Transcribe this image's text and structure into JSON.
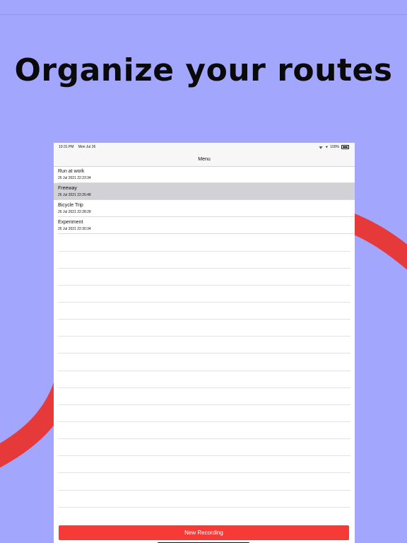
{
  "headline": "Organize your routes",
  "status_bar": {
    "time": "10:31 PM",
    "date": "Mon Jul 26",
    "battery": "100%"
  },
  "nav": {
    "title": "Menu"
  },
  "routes": [
    {
      "title": "Run at work",
      "date": "26 Jul 2021 22:23:34",
      "selected": false
    },
    {
      "title": "Freeway",
      "date": "26 Jul 2021 22:26:48",
      "selected": true
    },
    {
      "title": "Bicycle Trip",
      "date": "26 Jul 2021 22:28:28",
      "selected": false
    },
    {
      "title": "Experiment",
      "date": "26 Jul 2021 22:30:34",
      "selected": false
    }
  ],
  "new_recording_label": "New Recording",
  "colors": {
    "background": "#a3a6fd",
    "swoosh": "#e63a3a",
    "button": "#f63b37",
    "selected_row": "#d1d1d6"
  },
  "icons": {
    "wifi": "wifi-icon",
    "location": "location-arrow-icon",
    "battery": "battery-icon"
  }
}
